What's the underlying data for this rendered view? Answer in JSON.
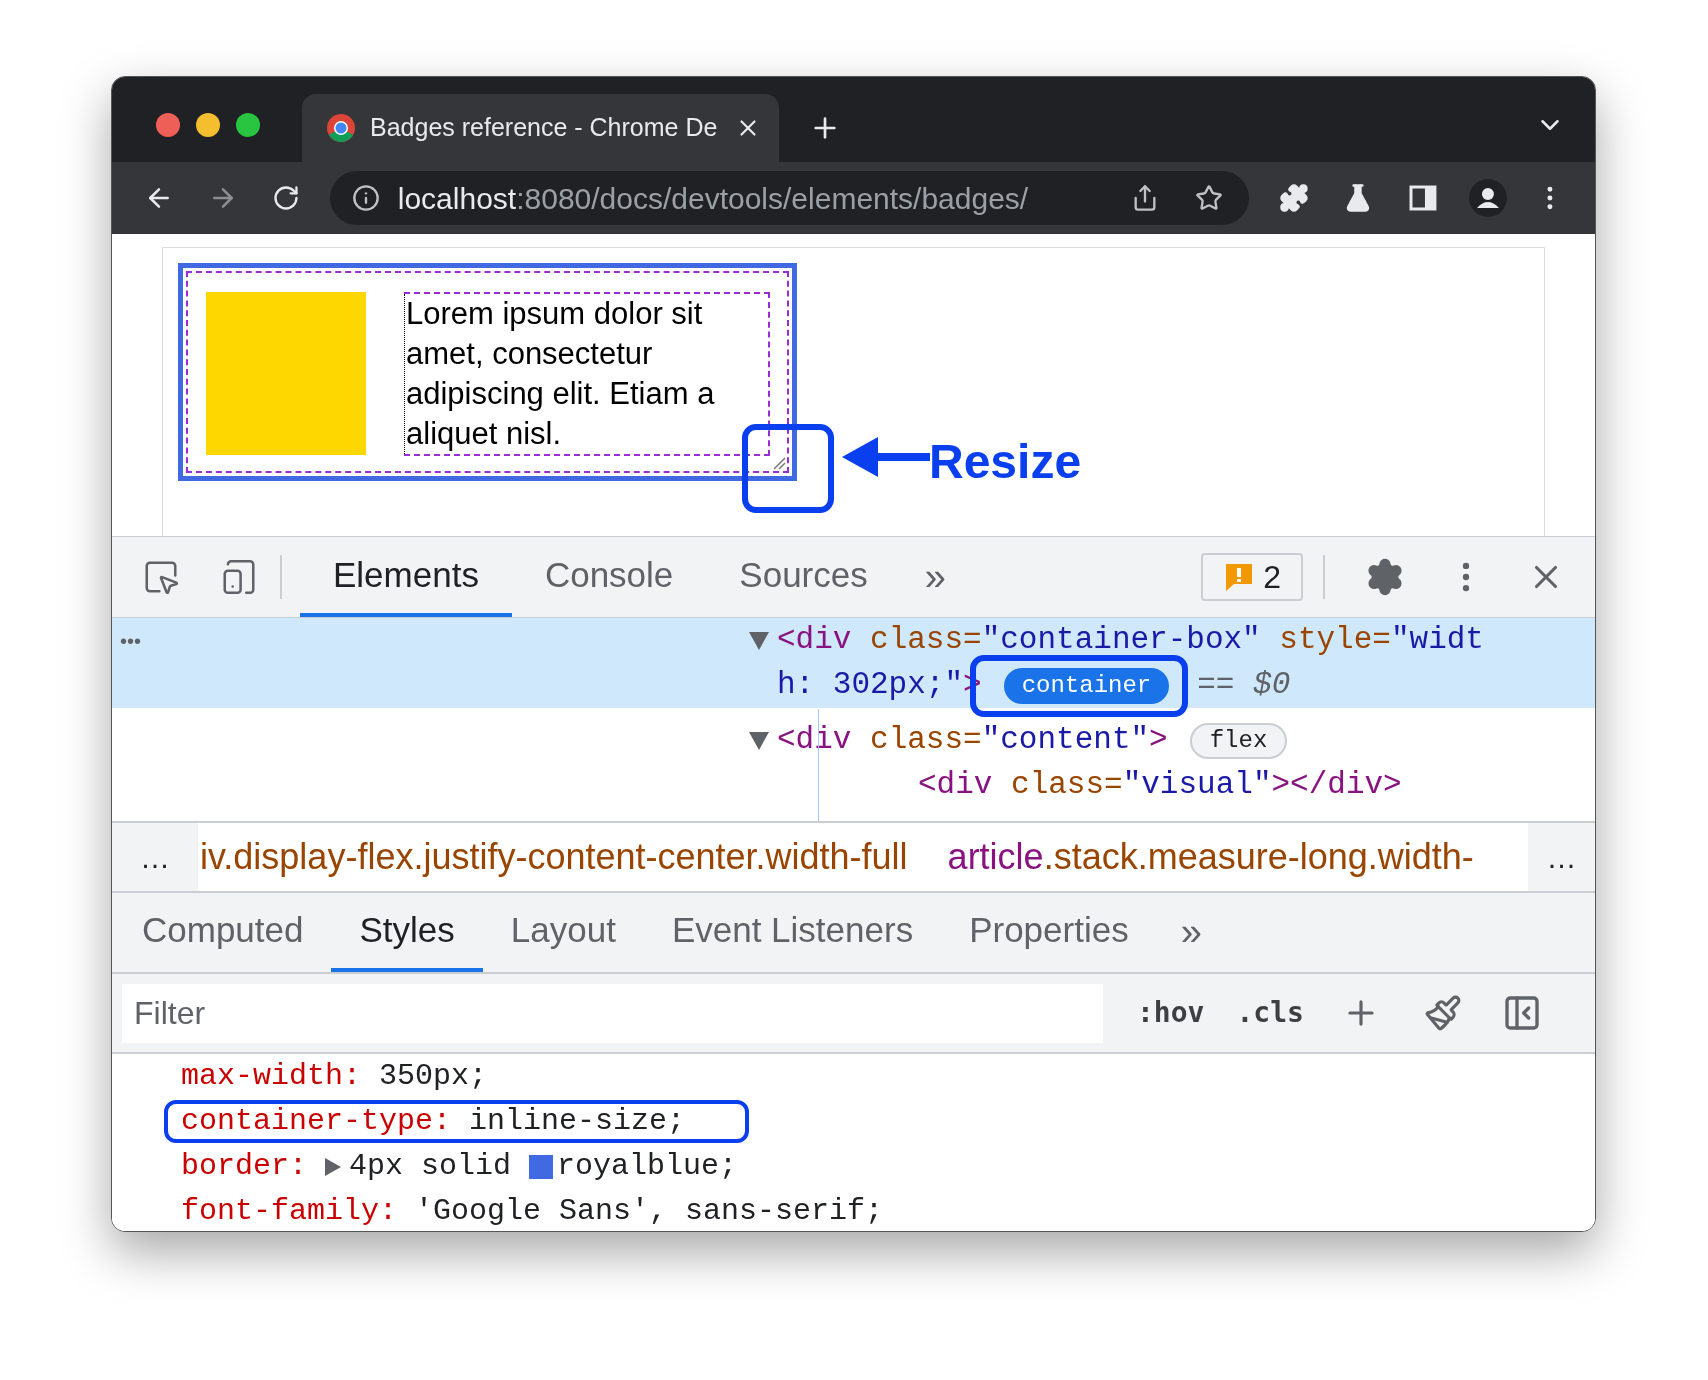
{
  "browser": {
    "tab": {
      "title": "Badges reference - Chrome De"
    },
    "address": {
      "host": "localhost",
      "path": ":8080/docs/devtools/elements/badges/"
    }
  },
  "page": {
    "demo_text": "Lorem ipsum dolor sit amet, consectetur adipiscing elit. Etiam a aliquet nisl.",
    "annotation": "Resize"
  },
  "devtools": {
    "tabs": [
      {
        "label": "Elements",
        "selected": true
      },
      {
        "label": "Console",
        "selected": false
      },
      {
        "label": "Sources",
        "selected": false
      }
    ],
    "more": "»",
    "issues_count": "2",
    "elements": {
      "ellipsis": "•••",
      "rows": [
        {
          "kind": "open",
          "selected": true,
          "expanded": true,
          "segments": [
            {
              "kind": "tag",
              "text": "<div"
            },
            {
              "kind": "attr",
              "text": " class="
            },
            {
              "kind": "value",
              "text": "\"container-box\""
            },
            {
              "kind": "attr",
              "text": " style="
            },
            {
              "kind": "value",
              "text": "\"widt"
            }
          ]
        },
        {
          "kind": "wrap",
          "selected": true,
          "segments": [
            {
              "kind": "value",
              "text": "h: 302px;\""
            },
            {
              "kind": "tag",
              "text": ">"
            }
          ],
          "badge": {
            "label": "container",
            "active": true,
            "highlighted": true
          },
          "suffix": "== $0"
        },
        {
          "kind": "open",
          "selected": false,
          "expanded": true,
          "segments": [
            {
              "kind": "tag",
              "text": "<div"
            },
            {
              "kind": "attr",
              "text": " class="
            },
            {
              "kind": "value",
              "text": "\"content\""
            },
            {
              "kind": "tag",
              "text": ">"
            }
          ],
          "badge": {
            "label": "flex",
            "active": false
          }
        },
        {
          "kind": "leaf",
          "selected": false,
          "segments": [
            {
              "kind": "tag",
              "text": "<div"
            },
            {
              "kind": "attr",
              "text": " class="
            },
            {
              "kind": "value",
              "text": "\"visual\""
            },
            {
              "kind": "tag",
              "text": "></div>"
            }
          ]
        }
      ]
    },
    "breadcrumbs": {
      "left": "…",
      "right": "…",
      "items": [
        {
          "classes": "iv.display-flex.justify-content-center.width-full"
        },
        {
          "tag": "article",
          "classes": ".stack.measure-long.width-"
        }
      ]
    },
    "subtabs": [
      {
        "label": "Computed",
        "selected": false
      },
      {
        "label": "Styles",
        "selected": true
      },
      {
        "label": "Layout",
        "selected": false
      },
      {
        "label": "Event Listeners",
        "selected": false
      },
      {
        "label": "Properties",
        "selected": false
      }
    ],
    "subtabs_more": "»",
    "filter": {
      "placeholder": "Filter",
      "hov": ":hov",
      "cls": ".cls"
    },
    "declarations": [
      {
        "property": "max-width:",
        "value": "350px;"
      },
      {
        "property": "container-type:",
        "value": "inline-size;",
        "highlighted": true
      },
      {
        "property": "border:",
        "expandable": true,
        "value": "4px solid",
        "color": "#4169e1",
        "value_after": "royalblue;"
      },
      {
        "property": "font-family:",
        "value": "'Google Sans', sans-serif;"
      }
    ]
  }
}
